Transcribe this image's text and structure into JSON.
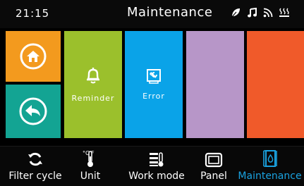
{
  "header": {
    "time": "21:15",
    "title": "Maintenance",
    "status_icons": [
      "leaf-icon",
      "music-note-icon",
      "wifi-icon",
      "heating-icon"
    ]
  },
  "tiles": {
    "home": {
      "icon": "home-icon",
      "color": "#f39a1e"
    },
    "back": {
      "icon": "back-arrow-icon",
      "color": "#13a493"
    },
    "reminder": {
      "label": "Reminder",
      "icon": "bell-icon",
      "color": "#9bc02c"
    },
    "error": {
      "label": "Error",
      "icon": "wrench-screen-icon",
      "color": "#0aa3e8"
    },
    "blank_purple": {
      "color": "#b796c8"
    },
    "blank_orange": {
      "color": "#f05a2a"
    }
  },
  "nav": {
    "items": [
      {
        "label": "Filter cycle",
        "icon": "cycle-icon",
        "active": false
      },
      {
        "label": "Unit",
        "icon": "thermometer-unit-icon",
        "active": false
      },
      {
        "label": "Work mode",
        "icon": "work-mode-icon",
        "active": false
      },
      {
        "label": "Panel",
        "icon": "panel-icon",
        "active": false
      },
      {
        "label": "Maintenance",
        "icon": "maintenance-icon",
        "active": true
      }
    ],
    "active_color": "#1aa2e0"
  }
}
